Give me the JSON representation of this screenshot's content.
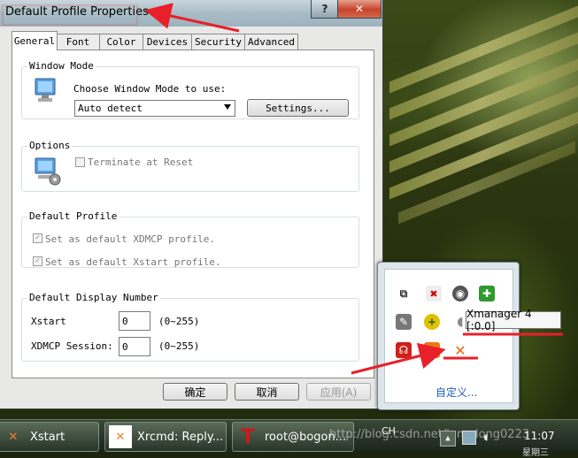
{
  "dialog": {
    "title": "Default Profile Properties",
    "help_symbol": "?",
    "close_symbol": "✕",
    "tabs": [
      "General",
      "Font",
      "Color",
      "Devices",
      "Security",
      "Advanced"
    ],
    "window_mode": {
      "label": "Window Mode",
      "prompt": "Choose Window Mode to use:",
      "selected": "Auto detect",
      "settings_button": "Settings..."
    },
    "options": {
      "label": "Options",
      "terminate_at_reset": "Terminate at Reset"
    },
    "default_profile": {
      "label": "Default Profile",
      "xdmcp": "Set as default XDMCP profile.",
      "xstart": "Set as default Xstart profile."
    },
    "display_number": {
      "label": "Default Display Number",
      "xstart_label": "Xstart",
      "xstart_value": "0",
      "xstart_range": "(0~255)",
      "xdmcp_label": "XDMCP Session:",
      "xdmcp_value": "0",
      "xdmcp_range": "(0~255)"
    },
    "buttons": {
      "ok": "确定",
      "cancel": "取消",
      "apply": "应用(A)"
    }
  },
  "tray": {
    "tooltip": "Xmanager 4 [:0.0]",
    "customize": "自定义..."
  },
  "taskbar": {
    "items": [
      {
        "label": "Xstart"
      },
      {
        "label": "Xrcmd: Reply..."
      },
      {
        "label": "root@bogon..."
      }
    ],
    "language": "CH",
    "time": "11:07",
    "date": "星期三",
    "watermark": "http://blog.csdn.net/longdong0223"
  },
  "colors": {
    "annotation_red": "#e8202a",
    "link_blue": "#1a5fbf",
    "close_red": "#c7432a"
  }
}
